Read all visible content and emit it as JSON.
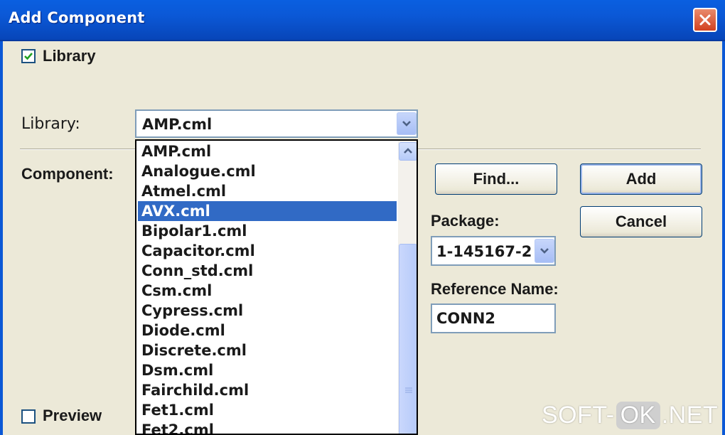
{
  "window": {
    "title": "Add Component"
  },
  "checkboxes": {
    "library": {
      "label": "Library",
      "checked": true
    },
    "preview": {
      "label": "Preview",
      "checked": false
    }
  },
  "labels": {
    "library": "Library:",
    "component": "Component:",
    "package": "Package:",
    "reference_name": "Reference Name:"
  },
  "library_combo": {
    "value": "AMP.cml",
    "options": [
      "AMP.cml",
      "Analogue.cml",
      "Atmel.cml",
      "AVX.cml",
      "Bipolar1.cml",
      "Capacitor.cml",
      "Conn_std.cml",
      "Csm.cml",
      "Cypress.cml",
      "Diode.cml",
      "Discrete.cml",
      "Dsm.cml",
      "Fairchild.cml",
      "Fet1.cml",
      "Fet2.cml"
    ],
    "highlighted": "AVX.cml"
  },
  "buttons": {
    "find": "Find...",
    "add": "Add",
    "cancel": "Cancel"
  },
  "package_combo": {
    "value": "1-145167-2"
  },
  "reference_input": {
    "value": "CONN2"
  },
  "watermark": {
    "pre": "SOFT-",
    "ok": "OK",
    "post": ".NET"
  },
  "colors": {
    "titlebar": "#0b58d6",
    "selection": "#316ac5",
    "dialog_bg": "#ece9d8",
    "close_button": "#d2411f"
  }
}
